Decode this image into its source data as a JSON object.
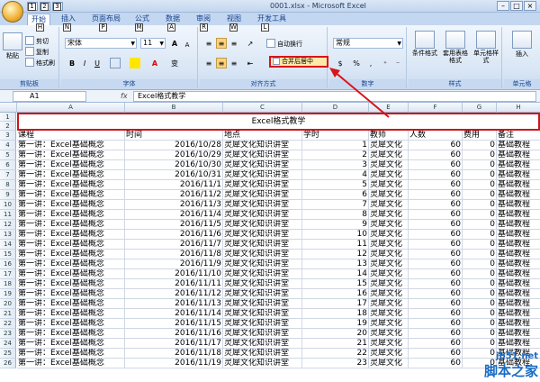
{
  "window": {
    "title": "0001.xlsx - Microsoft Excel",
    "quick_access": [
      "1",
      "2",
      "3"
    ],
    "controls": [
      "–",
      "□",
      "×"
    ]
  },
  "tabs": [
    {
      "label": "开始",
      "key": "H",
      "active": true
    },
    {
      "label": "插入",
      "key": "N",
      "active": false
    },
    {
      "label": "页面布局",
      "key": "P",
      "active": false
    },
    {
      "label": "公式",
      "key": "M",
      "active": false
    },
    {
      "label": "数据",
      "key": "A",
      "active": false
    },
    {
      "label": "审阅",
      "key": "R",
      "active": false
    },
    {
      "label": "视图",
      "key": "W",
      "active": false
    },
    {
      "label": "开发工具",
      "key": "L",
      "active": false
    }
  ],
  "ribbon": {
    "clipboard": {
      "label": "剪贴板",
      "paste": "粘贴",
      "cut": "剪切",
      "copy": "复制",
      "painter": "格式刷"
    },
    "font": {
      "label": "字体",
      "name": "宋体",
      "size": "11",
      "bold": "B",
      "italic": "I",
      "underline": "U",
      "grow": "A",
      "shrink": "A",
      "color": "A"
    },
    "alignment": {
      "label": "对齐方式",
      "wrap": "自动换行",
      "merge": "合并后居中"
    },
    "number": {
      "label": "数字",
      "format": "常规",
      "percent": "%",
      "comma": ","
    },
    "styles": {
      "label": "样式",
      "conditional": "条件格式",
      "table": "套用表格格式",
      "cell": "单元格样式"
    },
    "cells": {
      "label": "单元格",
      "insert": "插入"
    }
  },
  "formula_bar": {
    "name_box": "A1",
    "fx": "fx",
    "content": "Excel格式教学"
  },
  "columns": [
    "A",
    "B",
    "C",
    "D",
    "E",
    "F",
    "G",
    "H"
  ],
  "merged_title": {
    "text": "Excel格式教学",
    "rows": [
      "1",
      "2"
    ]
  },
  "header_row": {
    "number": "3",
    "cells": [
      "课程",
      "时间",
      "地点",
      "学时",
      "教师",
      "人数",
      "费用",
      "备注"
    ]
  },
  "data_rows": [
    {
      "n": "4",
      "a": "第一讲：Excel基础概念",
      "b": "2016/10/28",
      "c": "灵犀文化知识讲堂",
      "d": "1",
      "e": "灵犀文化",
      "f": "60",
      "g": "0",
      "h": "基础教程"
    },
    {
      "n": "5",
      "a": "第一讲：Excel基础概念",
      "b": "2016/10/29",
      "c": "灵犀文化知识讲堂",
      "d": "2",
      "e": "灵犀文化",
      "f": "60",
      "g": "0",
      "h": "基础教程"
    },
    {
      "n": "6",
      "a": "第一讲：Excel基础概念",
      "b": "2016/10/30",
      "c": "灵犀文化知识讲堂",
      "d": "3",
      "e": "灵犀文化",
      "f": "60",
      "g": "0",
      "h": "基础教程"
    },
    {
      "n": "7",
      "a": "第一讲：Excel基础概念",
      "b": "2016/10/31",
      "c": "灵犀文化知识讲堂",
      "d": "4",
      "e": "灵犀文化",
      "f": "60",
      "g": "0",
      "h": "基础教程"
    },
    {
      "n": "8",
      "a": "第一讲：Excel基础概念",
      "b": "2016/11/1",
      "c": "灵犀文化知识讲堂",
      "d": "5",
      "e": "灵犀文化",
      "f": "60",
      "g": "0",
      "h": "基础教程"
    },
    {
      "n": "9",
      "a": "第一讲：Excel基础概念",
      "b": "2016/11/2",
      "c": "灵犀文化知识讲堂",
      "d": "6",
      "e": "灵犀文化",
      "f": "60",
      "g": "0",
      "h": "基础教程"
    },
    {
      "n": "10",
      "a": "第一讲：Excel基础概念",
      "b": "2016/11/3",
      "c": "灵犀文化知识讲堂",
      "d": "7",
      "e": "灵犀文化",
      "f": "60",
      "g": "0",
      "h": "基础教程"
    },
    {
      "n": "11",
      "a": "第一讲：Excel基础概念",
      "b": "2016/11/4",
      "c": "灵犀文化知识讲堂",
      "d": "8",
      "e": "灵犀文化",
      "f": "60",
      "g": "0",
      "h": "基础教程"
    },
    {
      "n": "12",
      "a": "第一讲：Excel基础概念",
      "b": "2016/11/5",
      "c": "灵犀文化知识讲堂",
      "d": "9",
      "e": "灵犀文化",
      "f": "60",
      "g": "0",
      "h": "基础教程"
    },
    {
      "n": "13",
      "a": "第一讲：Excel基础概念",
      "b": "2016/11/6",
      "c": "灵犀文化知识讲堂",
      "d": "10",
      "e": "灵犀文化",
      "f": "60",
      "g": "0",
      "h": "基础教程"
    },
    {
      "n": "14",
      "a": "第一讲：Excel基础概念",
      "b": "2016/11/7",
      "c": "灵犀文化知识讲堂",
      "d": "11",
      "e": "灵犀文化",
      "f": "60",
      "g": "0",
      "h": "基础教程"
    },
    {
      "n": "15",
      "a": "第一讲：Excel基础概念",
      "b": "2016/11/8",
      "c": "灵犀文化知识讲堂",
      "d": "12",
      "e": "灵犀文化",
      "f": "60",
      "g": "0",
      "h": "基础教程"
    },
    {
      "n": "16",
      "a": "第一讲：Excel基础概念",
      "b": "2016/11/9",
      "c": "灵犀文化知识讲堂",
      "d": "13",
      "e": "灵犀文化",
      "f": "60",
      "g": "0",
      "h": "基础教程"
    },
    {
      "n": "17",
      "a": "第一讲：Excel基础概念",
      "b": "2016/11/10",
      "c": "灵犀文化知识讲堂",
      "d": "14",
      "e": "灵犀文化",
      "f": "60",
      "g": "0",
      "h": "基础教程"
    },
    {
      "n": "18",
      "a": "第一讲：Excel基础概念",
      "b": "2016/11/11",
      "c": "灵犀文化知识讲堂",
      "d": "15",
      "e": "灵犀文化",
      "f": "60",
      "g": "0",
      "h": "基础教程"
    },
    {
      "n": "19",
      "a": "第一讲：Excel基础概念",
      "b": "2016/11/12",
      "c": "灵犀文化知识讲堂",
      "d": "16",
      "e": "灵犀文化",
      "f": "60",
      "g": "0",
      "h": "基础教程"
    },
    {
      "n": "20",
      "a": "第一讲：Excel基础概念",
      "b": "2016/11/13",
      "c": "灵犀文化知识讲堂",
      "d": "17",
      "e": "灵犀文化",
      "f": "60",
      "g": "0",
      "h": "基础教程"
    },
    {
      "n": "21",
      "a": "第一讲：Excel基础概念",
      "b": "2016/11/14",
      "c": "灵犀文化知识讲堂",
      "d": "18",
      "e": "灵犀文化",
      "f": "60",
      "g": "0",
      "h": "基础教程"
    },
    {
      "n": "22",
      "a": "第一讲：Excel基础概念",
      "b": "2016/11/15",
      "c": "灵犀文化知识讲堂",
      "d": "19",
      "e": "灵犀文化",
      "f": "60",
      "g": "0",
      "h": "基础教程"
    },
    {
      "n": "23",
      "a": "第一讲：Excel基础概念",
      "b": "2016/11/16",
      "c": "灵犀文化知识讲堂",
      "d": "20",
      "e": "灵犀文化",
      "f": "60",
      "g": "0",
      "h": "基础教程"
    },
    {
      "n": "24",
      "a": "第一讲：Excel基础概念",
      "b": "2016/11/17",
      "c": "灵犀文化知识讲堂",
      "d": "21",
      "e": "灵犀文化",
      "f": "60",
      "g": "0",
      "h": "基础教程"
    },
    {
      "n": "25",
      "a": "第一讲：Excel基础概念",
      "b": "2016/11/18",
      "c": "灵犀文化知识讲堂",
      "d": "22",
      "e": "灵犀文化",
      "f": "60",
      "g": "0",
      "h": "基础教程"
    },
    {
      "n": "26",
      "a": "第一讲：Excel基础概念",
      "b": "2016/11/19",
      "c": "灵犀文化知识讲堂",
      "d": "23",
      "e": "灵犀文化",
      "f": "60",
      "g": "0",
      "h": "基础教程"
    }
  ],
  "watermark": {
    "line1": "jb51.net",
    "line2": "脚本之家"
  },
  "colors": {
    "highlight": "#d9141a",
    "ribbon": "#d9e6f5",
    "tab_text": "#15428b"
  }
}
